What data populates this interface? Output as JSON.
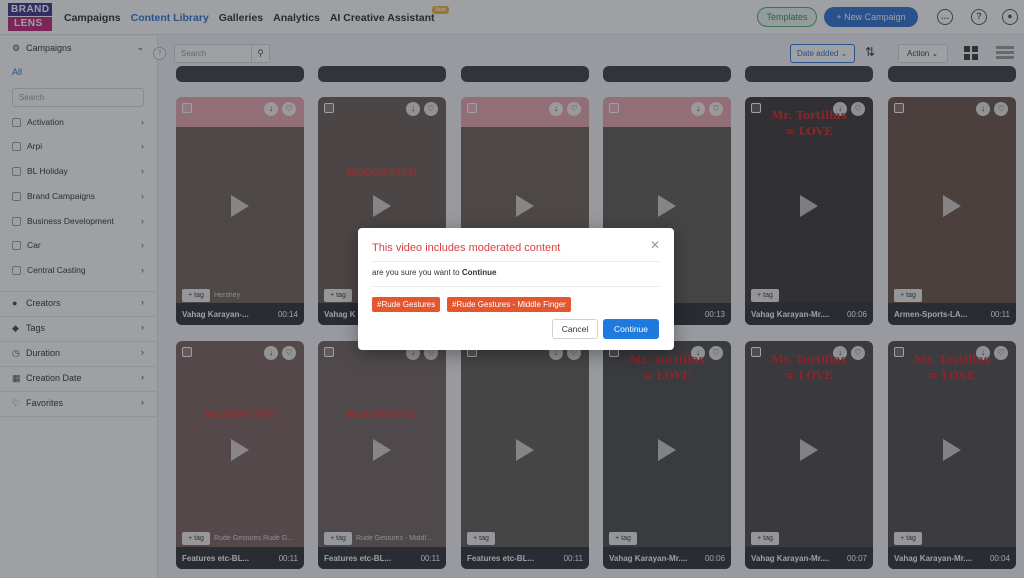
{
  "header": {
    "logo_top": "BRAND",
    "logo_bottom": "LENS",
    "nav": [
      "Campaigns",
      "Content Library",
      "Galleries",
      "Analytics",
      "AI Creative Assistant"
    ],
    "new_badge": "New",
    "templates_label": "Templates",
    "new_campaign_label": "+ New Campaign"
  },
  "sidebar": {
    "campaigns_label": "Campaigns",
    "all_label": "All",
    "search_placeholder": "Search",
    "campaign_items": [
      "Activation",
      "Arpi",
      "BL Holiday",
      "Brand Campaigns",
      "Business Development",
      "Car",
      "Central Casting"
    ],
    "filters": [
      "Creators",
      "Tags",
      "Duration",
      "Creation Date",
      "Favorites"
    ]
  },
  "toolbar": {
    "search_placeholder": "Search",
    "date_added_label": "Date added",
    "action_label": "Action"
  },
  "cards_row1": [
    {
      "tag_label": "+ tag",
      "tag_text": "Hershey",
      "title": "Vahag Karayan-...",
      "duration": "00:14"
    },
    {
      "tag_label": "+ tag",
      "tag_text": "",
      "title": "Vahag K",
      "duration": "",
      "moderated": "MODERATED"
    },
    {
      "tag_label": "",
      "tag_text": "",
      "title": "",
      "duration": ""
    },
    {
      "tag_label": "",
      "tag_text": "",
      "title": "",
      "duration": "00:13"
    },
    {
      "tag_label": "+ tag",
      "tag_text": "",
      "title": "Vahag Karayan-Mr....",
      "duration": "00:06",
      "brand": "Mr. Tortillas",
      "brand_sub": "= LOVE"
    },
    {
      "tag_label": "+ tag",
      "tag_text": "",
      "title": "Armen-Sports-LA...",
      "duration": "00:11"
    }
  ],
  "cards_row2": [
    {
      "tag_label": "+ tag",
      "tag_text": "Rude Gestures Rude G...",
      "title": "Features etc-BL...",
      "duration": "00:11",
      "moderated": "MODERATED"
    },
    {
      "tag_label": "+ tag",
      "tag_text": "Rude Gestures - Middl...",
      "title": "Features etc-BL...",
      "duration": "00:11",
      "moderated": "MODERATED"
    },
    {
      "tag_label": "+ tag",
      "tag_text": "",
      "title": "Features etc-BL...",
      "duration": "00:11"
    },
    {
      "tag_label": "+ tag",
      "tag_text": "",
      "title": "Vahag Karayan-Mr....",
      "duration": "00:06",
      "brand": "Mr. Tortillas",
      "brand_sub": "= LOVE"
    },
    {
      "tag_label": "+ tag",
      "tag_text": "",
      "title": "Vahag Karayan-Mr....",
      "duration": "00:07",
      "brand": "Mr. Tortillas",
      "brand_sub": "= LOVE"
    },
    {
      "tag_label": "+ tag",
      "tag_text": "",
      "title": "Vahag Karayan-Mr....",
      "duration": "00:04",
      "brand": "Mr. Tortillas",
      "brand_sub": "= LOVE"
    }
  ],
  "modal": {
    "title": "This video includes moderated content",
    "message_prefix": "are you sure you want to ",
    "message_action": "Continue",
    "tags": [
      "#Rude Gestures",
      "#Rude Gestures - Middle Finger"
    ],
    "cancel_label": "Cancel",
    "continue_label": "Continue"
  },
  "colors": {
    "accent": "#2b6fd6",
    "modal_title": "#d94040",
    "tag_chip": "#e4562e",
    "moderated_text": "#e0382e"
  }
}
